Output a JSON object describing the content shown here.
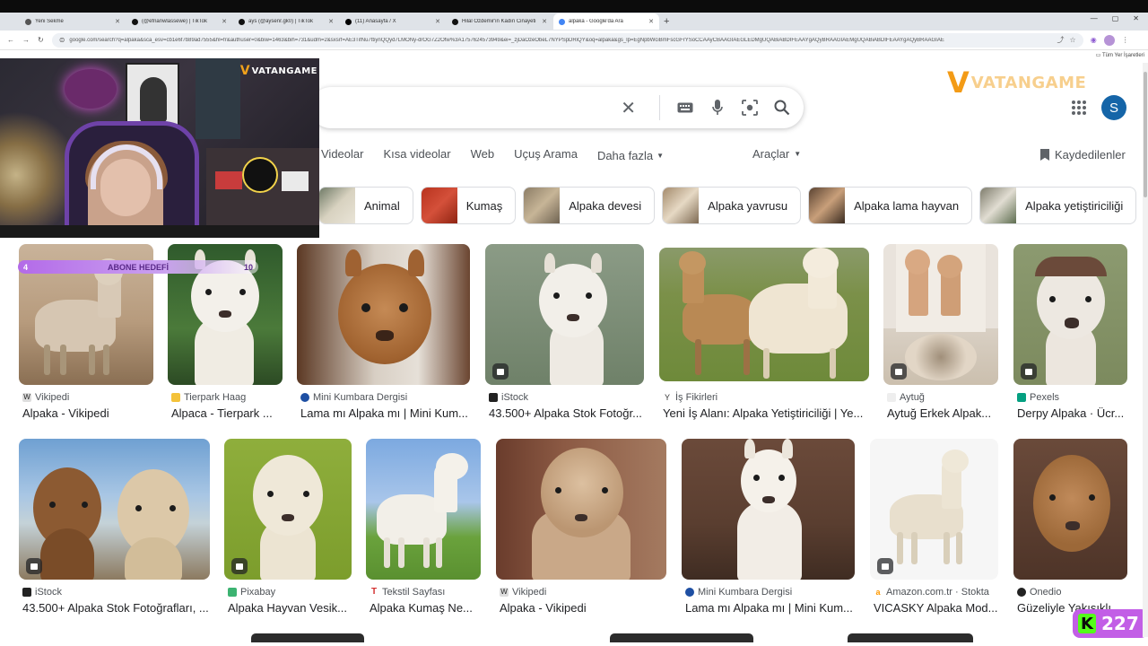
{
  "browser": {
    "tabs": [
      {
        "title": "Yeni Sekme",
        "active": false
      },
      {
        "title": "(@efnanwlassewe) | TikTok",
        "active": false
      },
      {
        "title": "ays (@aysenr.gk0) | TikTok",
        "active": false
      },
      {
        "title": "(11) Anasayfa / X",
        "active": false
      },
      {
        "title": "Hilal Özdemir'in Kadın Cinayeti",
        "active": false
      },
      {
        "title": "alpaka - Google'da Ara",
        "active": true
      }
    ],
    "url": "google.com/search?q=alpaka&sca_esv=cb1e6f7b89ad7555&hl=fr&authuser=0&biw=1463&bih=731&udm=2&sxsrf=AE3TifNu7ttiynQQyd7LMONy-drOG7Z2Ofw%3A1757624573949&ei=_zjDaOzeObeL7NYPSpDRiQY&oq=alpaka&gs_lp=EgNpbWciBmFscGFrYSoCCAAyCBAAGIAEGLEDMgUQABiABDIFEAAYgAQyBRAAGIAEMgUQABiABDIFEAAYgAQyBRAAGIAE",
    "all_bookmarks": "Tüm Yer İşaretleri"
  },
  "webcam": {
    "brand_v": "V",
    "brand_text": "VATANGAME"
  },
  "logo": {
    "v": "V",
    "text": "VATANGAME"
  },
  "account": {
    "initial": "S"
  },
  "filters": {
    "items": [
      "Videolar",
      "Kısa videolar",
      "Web",
      "Uçuş Arama"
    ],
    "more": "Daha fazla",
    "tools": "Araçlar",
    "saved": "Kaydedilenler"
  },
  "chips": [
    "Animal",
    "Kumaş",
    "Alpaka devesi",
    "Alpaka yavrusu",
    "Alpaka lama hayvan",
    "Alpaka yetiştiriciliği"
  ],
  "results_row1": [
    {
      "source": "Vikipedi",
      "title": "Alpaka - Vikipedi"
    },
    {
      "source": "Tierpark Haag",
      "title": "Alpaca - Tierpark ..."
    },
    {
      "source": "Mini Kumbara Dergisi",
      "title": "Lama mı Alpaka mı | Mini Kum..."
    },
    {
      "source": "iStock",
      "title": "43.500+ Alpaka Stok Fotoğr..."
    },
    {
      "source": "İş Fikirleri",
      "title": "Yeni İş Alanı: Alpaka Yetiştiriciliği | Ye..."
    },
    {
      "source": "Aytuğ",
      "title": "Aytuğ Erkek Alpak..."
    },
    {
      "source": "Pexels",
      "title": "Derpy Alpaka · Ücr..."
    }
  ],
  "results_row2": [
    {
      "source": "iStock",
      "title": "43.500+ Alpaka Stok Fotoğrafları, ..."
    },
    {
      "source": "Pixabay",
      "title": "Alpaka Hayvan Vesik..."
    },
    {
      "source": "Tekstil Sayfası",
      "title": "Alpaka Kumaş Ne..."
    },
    {
      "source": "Vikipedi",
      "title": "Alpaka - Vikipedi"
    },
    {
      "source": "Mini Kumbara Dergisi",
      "title": "Lama mı Alpaka mı | Mini Kum..."
    },
    {
      "source": "Amazon.com.tr · Stokta",
      "title": "VICASKY Alpaka Mod..."
    },
    {
      "source": "Onedio",
      "title": "Güzeliyle Yakışıklı..."
    }
  ],
  "overlay": {
    "goal_left": "4",
    "goal_label": "ABONE HEDEFİ",
    "goal_right": "10",
    "kick_letter": "K",
    "kick_count": "227"
  },
  "colors": {
    "accent_blue": "#1565a8",
    "kick_green": "#53fc18",
    "kick_purple": "#c25ee6",
    "vatan_orange": "#f39b16"
  }
}
